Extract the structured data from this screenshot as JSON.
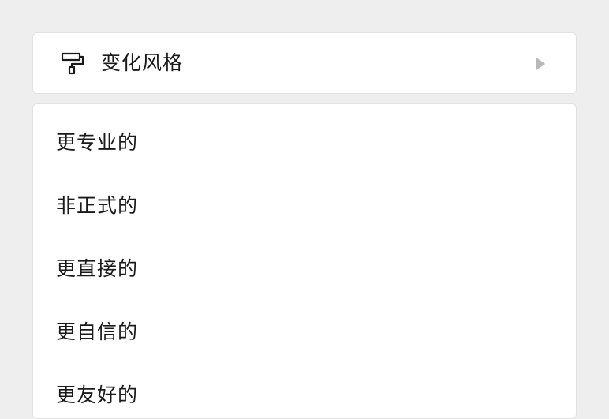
{
  "style_menu": {
    "label": "变化风格",
    "icon": "paint-roller-icon",
    "arrow_icon": "chevron-right-icon",
    "arrow_color": "#b8b8b8"
  },
  "options": [
    {
      "label": "更专业的"
    },
    {
      "label": "非正式的"
    },
    {
      "label": "更直接的"
    },
    {
      "label": "更自信的"
    },
    {
      "label": "更友好的"
    }
  ]
}
